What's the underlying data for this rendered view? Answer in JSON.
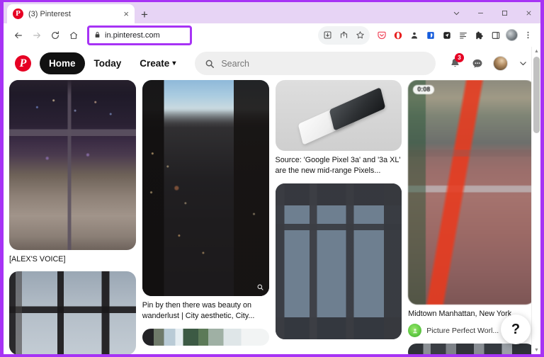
{
  "annotation": {
    "highlight_color": "#a733f5"
  },
  "window": {
    "controls": [
      {
        "name": "tab-search",
        "glyph": "chevron-down"
      },
      {
        "name": "minimize",
        "glyph": "minus"
      },
      {
        "name": "maximize",
        "glyph": "square"
      },
      {
        "name": "close",
        "glyph": "x"
      }
    ]
  },
  "tabstrip": {
    "tab": {
      "title": "(3) Pinterest",
      "favicon_letter": "P",
      "close_label": "×"
    },
    "new_tab_label": "+"
  },
  "toolbar": {
    "back_label": "←",
    "forward_label": "→",
    "reload_label": "C",
    "home_label": "⌂",
    "url": "in.pinterest.com",
    "lock_icon": "lock-icon",
    "icons": [
      "install-download-icon",
      "share-icon",
      "bookmark-star-icon",
      "pocket-icon",
      "opera-icon",
      "dark-reader-icon",
      "password-manager-icon",
      "navigation-icon",
      "reading-list-icon",
      "extensions-puzzle-icon",
      "side-panel-icon"
    ],
    "profile_icon": "profile-avatar",
    "menu_label": "⋮"
  },
  "pinterest": {
    "logo": "pinterest-logo",
    "nav": [
      {
        "label": "Home",
        "active": true
      },
      {
        "label": "Today",
        "active": false
      },
      {
        "label": "Create",
        "active": false,
        "chevron": "▾"
      }
    ],
    "search": {
      "placeholder": "Search",
      "value": "",
      "icon": "search-icon"
    },
    "actions": {
      "notifications": {
        "icon": "bell-icon",
        "badge": "3"
      },
      "messages": {
        "icon": "message-bubble-icon"
      },
      "avatar": {
        "icon": "user-avatar"
      },
      "account_menu": {
        "icon": "chevron-down-icon"
      }
    }
  },
  "grid": {
    "columns": [
      {
        "pins": [
          {
            "art": "art-bedroom",
            "caption": "[ALEX'S VOICE]",
            "video_badge": "",
            "attribution": ""
          },
          {
            "art": "art-windowpane",
            "caption": "",
            "video_badge": "",
            "attribution": ""
          }
        ]
      },
      {
        "pins": [
          {
            "art": "art-nycdusk",
            "caption": "Pin by then there was beauty on wanderlust | City aesthetic, City...",
            "video_badge": "",
            "attribution": ""
          },
          {
            "art": "art-strip-a",
            "caption": "",
            "video_badge": "",
            "attribution": ""
          }
        ]
      },
      {
        "pins": [
          {
            "art": "art-pixel",
            "caption": "Source: 'Google Pixel 3a' and '3a XL' are the new mid-range Pixels...",
            "video_badge": "",
            "attribution": ""
          },
          {
            "art": "art-balcony",
            "caption": "",
            "video_badge": "",
            "attribution": ""
          }
        ]
      },
      {
        "pins": [
          {
            "art": "art-video",
            "caption": "Midtown Manhattan, New York...",
            "video_badge": "0:08",
            "attribution": "Picture Perfect Worl..."
          },
          {
            "art": "art-strip-b",
            "caption": "",
            "video_badge": "",
            "attribution": ""
          }
        ]
      }
    ]
  },
  "help": {
    "label": "?"
  },
  "scrollbar": {
    "up_arrow": "▲",
    "down_arrow": "▼"
  }
}
